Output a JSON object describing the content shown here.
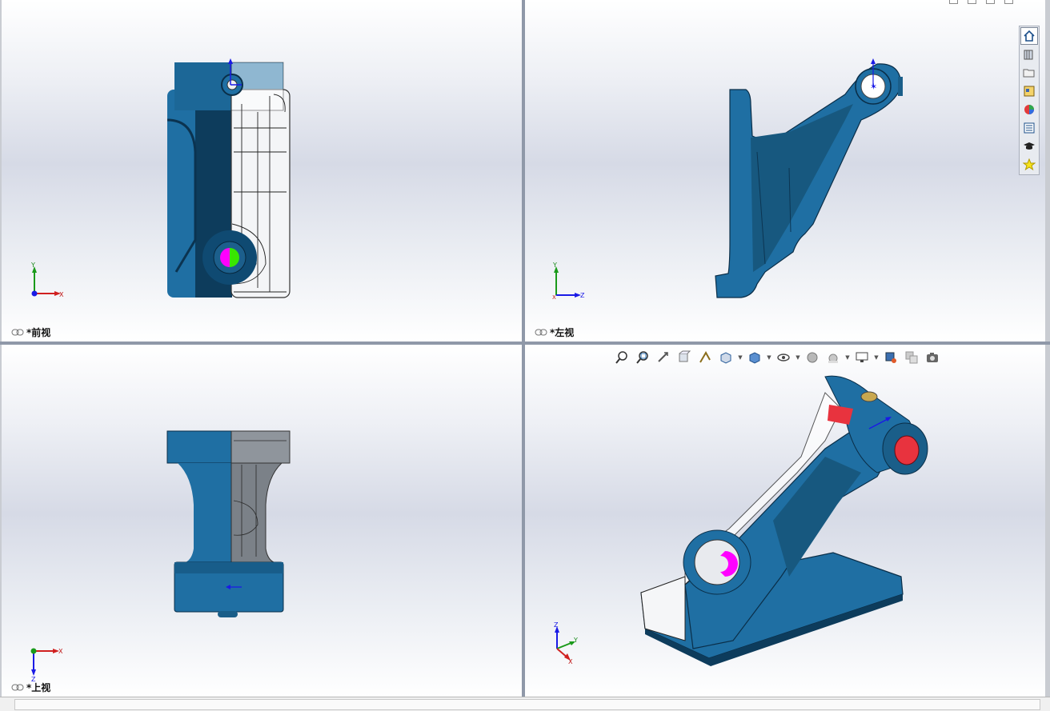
{
  "viewports": {
    "front": {
      "label": "*前视"
    },
    "left": {
      "label": "*左视"
    },
    "top": {
      "label": "*上视"
    },
    "iso": {
      "label": ""
    }
  },
  "triads": {
    "front": {
      "up": "Y",
      "right": "X"
    },
    "left": {
      "up": "Y",
      "right": "Z",
      "origin": "X"
    },
    "top": {
      "down": "Z",
      "right": "X"
    },
    "iso": {
      "up": "Z",
      "right": "Y",
      "front": "X"
    }
  },
  "heads_up_toolbar": [
    "zoom-to-fit",
    "zoom-to-area",
    "previous-view",
    "section-view",
    "dynamic-annotation",
    "view-orientation",
    "display-style",
    "hide-show-items",
    "edit-appearance",
    "apply-scene",
    "view-settings",
    "rotate-view",
    "3d-drawing-view",
    "screen-capture"
  ],
  "task_pane": [
    "home",
    "design-library",
    "file-explorer",
    "view-palette",
    "appearances",
    "custom-properties",
    "tutorials",
    "favorites"
  ],
  "colors": {
    "model_blue": "#1f6fa3",
    "model_dark": "#0d3c5c",
    "highlight_magenta": "#ff00ff",
    "highlight_green": "#39e600",
    "highlight_red": "#e8333e"
  }
}
